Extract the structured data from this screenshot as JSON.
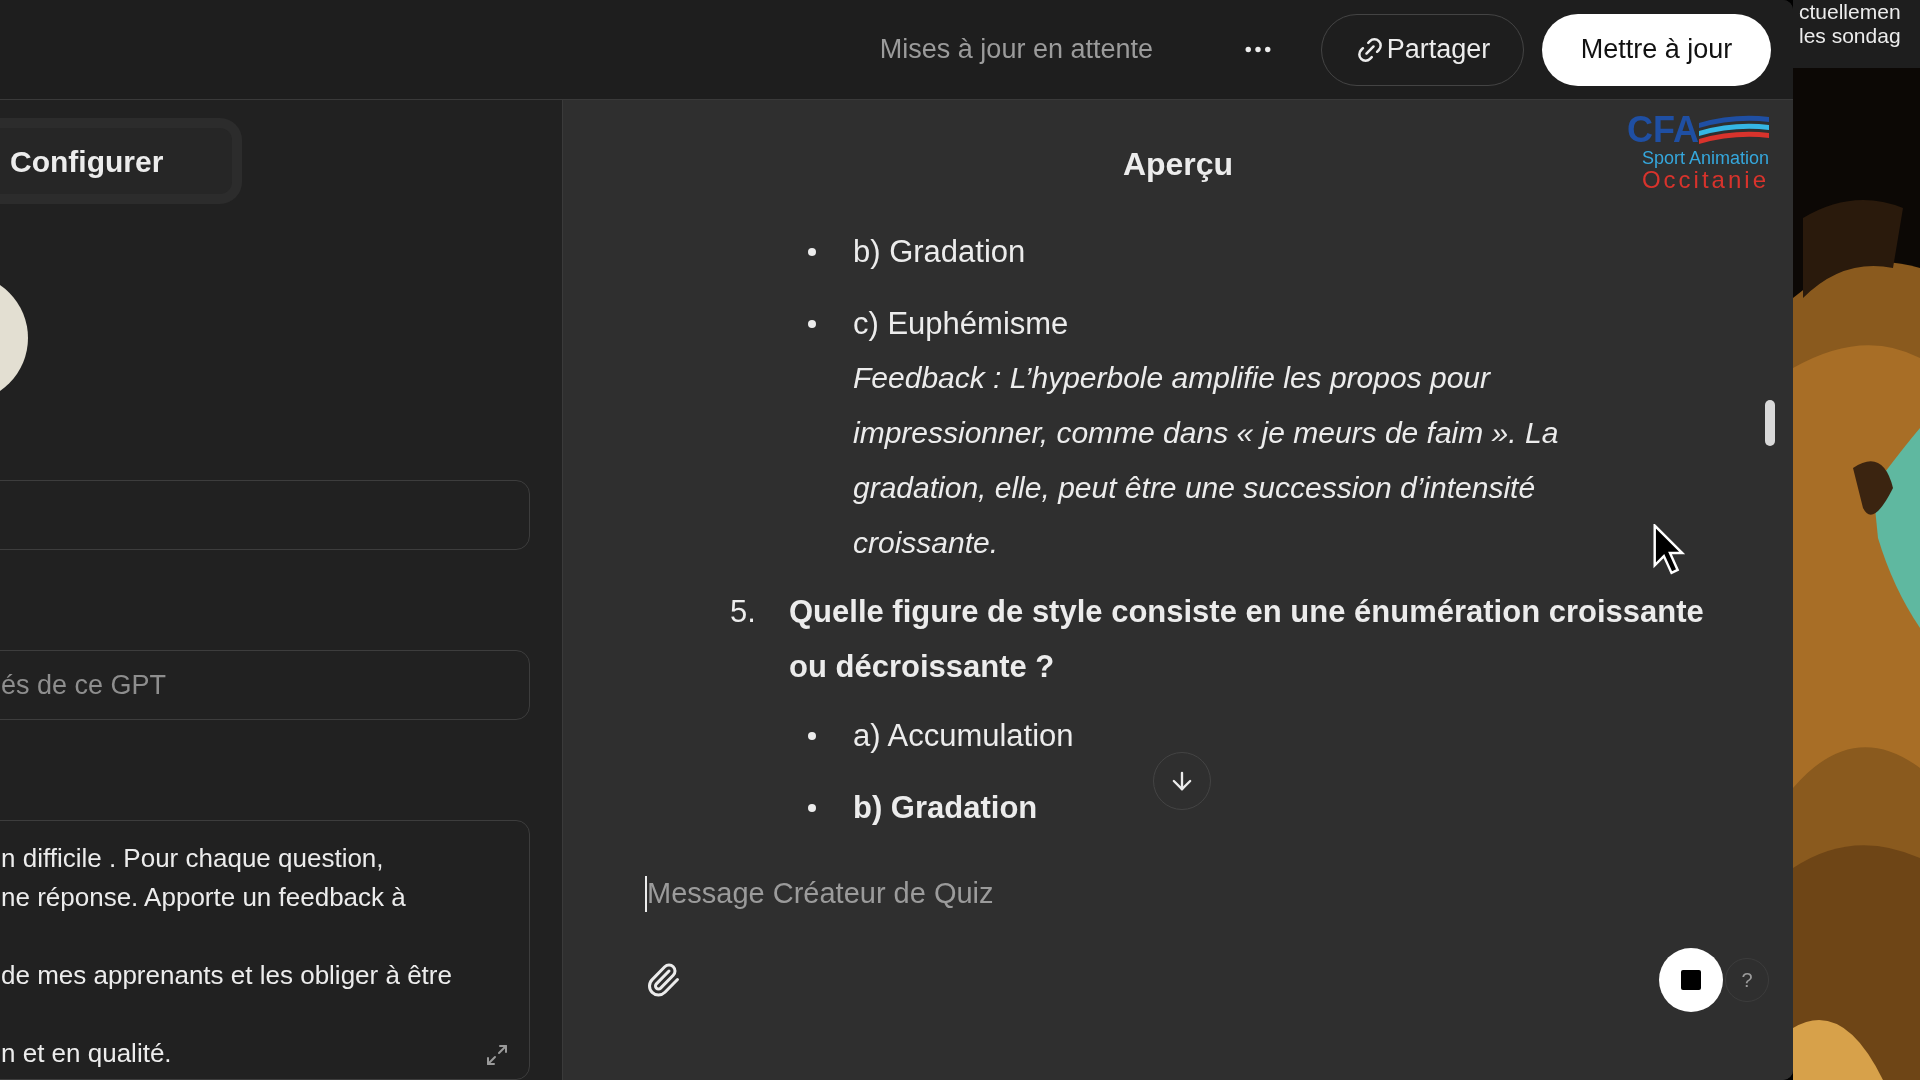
{
  "top_bar": {
    "status": "Mises à jour en attente",
    "share_button": "Partager",
    "update_button": "Mettre à jour"
  },
  "side_strip": {
    "lines": [
      "ctuellemen",
      "les sondag"
    ]
  },
  "configure_panel": {
    "tab": {
      "label": "Configurer",
      "selected": true
    },
    "fields": [
      {
        "kind": "input"
      },
      {
        "kind": "input",
        "placeholder": "és de ce GPT"
      },
      {
        "kind": "textarea",
        "paragraphs": [
          [
            "n difficile . Pour chaque question,",
            "ne réponse. Apporte un feedback à"
          ],
          [
            "de mes apprenants et les obliger à être"
          ],
          [
            "n et en qualité."
          ]
        ]
      }
    ]
  },
  "preview": {
    "title": "Aperçu",
    "logo": {
      "mark": "CFA",
      "line_1": "Sport Animation",
      "line_2": "Occitanie"
    },
    "items": [
      {
        "kind": "option",
        "text": "b) Gradation",
        "bold": false
      },
      {
        "kind": "option",
        "text": "c) Euphémisme",
        "bold": false,
        "feedback": "Feedback : L’hyperbole amplifie les propos pour impressionner, comme dans « je meurs de faim ». La gradation, elle, peut être une succession d’intensité croissante."
      },
      {
        "kind": "question",
        "number": "5.",
        "text": "Quelle figure de style consiste en une énumération croissante ou décroissante ?"
      },
      {
        "kind": "option",
        "text": "a) Accumulation",
        "bold": false
      },
      {
        "kind": "option",
        "text": "b) Gradation",
        "bold": true
      }
    ],
    "composer": {
      "placeholder": "Message Créateur de Quiz",
      "help": "?"
    }
  }
}
